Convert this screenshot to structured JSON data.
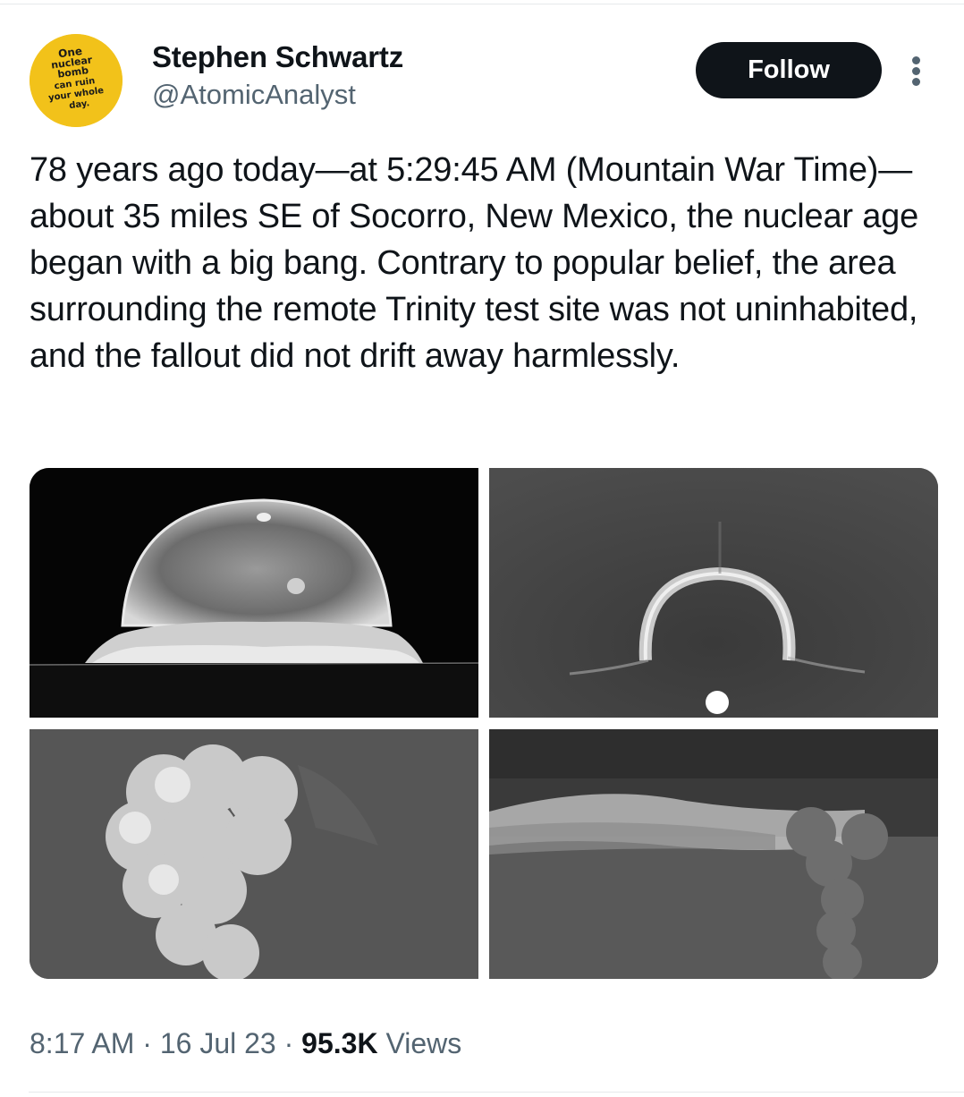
{
  "author": {
    "name": "Stephen Schwartz",
    "handle": "@AtomicAnalyst",
    "avatar_lines": [
      "One",
      "nuclear",
      "bomb",
      "can ruin",
      "your whole",
      "day."
    ],
    "avatar_color": "#f2c21a"
  },
  "actions": {
    "follow_label": "Follow",
    "more_icon": "more-vertical-icon"
  },
  "tweet": {
    "text": "78 years ago today—at 5:29:45 AM (Mountain War Time)—about 35 miles SE of Socorro, New Mexico, the nuclear age began with a big bang. Contrary to popular belief, the area surrounding the remote Trinity test site was not uninhabited, and the fallout did not drift away harmlessly."
  },
  "meta": {
    "time": "8:17 AM",
    "sep1": " · ",
    "date": "16 Jul 23",
    "sep2": " · ",
    "views_count": "95.3K",
    "views_label": " Views"
  },
  "colors": {
    "text_primary": "#0f1419",
    "text_secondary": "#536471",
    "follow_bg": "#0f1419",
    "divider": "#e6e9eb"
  }
}
